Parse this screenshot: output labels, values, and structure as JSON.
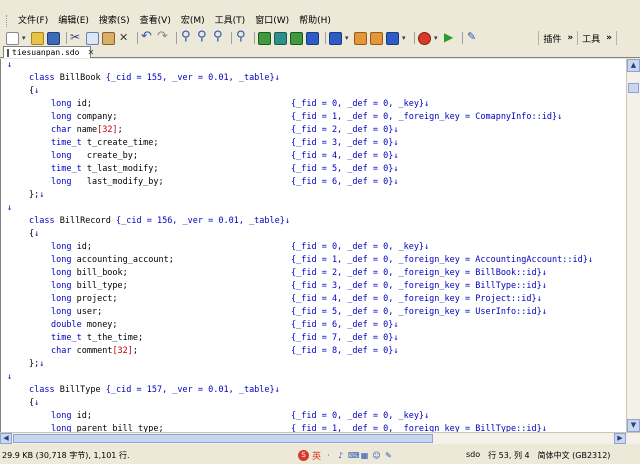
{
  "menubar": {
    "items": [
      "文件(F)",
      "编辑(E)",
      "搜索(S)",
      "查看(V)",
      "宏(M)",
      "工具(T)",
      "窗口(W)",
      "帮助(H)"
    ]
  },
  "toolbar": {
    "plugins_label": "插件",
    "tools_label": "工具",
    "chevron": "»"
  },
  "tab": {
    "label": "tiesuanpan.sdo",
    "close": "✕"
  },
  "code": {
    "eol": "↓",
    "lines": [
      {
        "indent": 0,
        "left": "",
        "right": ""
      },
      {
        "indent": 1,
        "left": "class BillBook {_cid = 155, _ver = 0.01, _table}",
        "right": ""
      },
      {
        "indent": 1,
        "left": "{",
        "right": ""
      },
      {
        "indent": 2,
        "left": "long id;",
        "right": "{_fid = 0, _def = 0, _key}"
      },
      {
        "indent": 2,
        "left": "long company;",
        "right": "{_fid = 1, _def = 0, _foreign_key = ComapnyInfo::id}"
      },
      {
        "indent": 2,
        "left": "char name[32];",
        "right": "{_fid = 2, _def = 0}"
      },
      {
        "indent": 2,
        "left": "time_t t_create_time;",
        "right": "{_fid = 3, _def = 0}"
      },
      {
        "indent": 2,
        "left": "long   create_by;",
        "right": "{_fid = 4, _def = 0}"
      },
      {
        "indent": 2,
        "left": "time_t t_last_modify;",
        "right": "{_fid = 5, _def = 0}"
      },
      {
        "indent": 2,
        "left": "long   last_modify_by;",
        "right": "{_fid = 6, _def = 0}"
      },
      {
        "indent": 1,
        "left": "};",
        "right": ""
      },
      {
        "indent": 0,
        "left": "",
        "right": ""
      },
      {
        "indent": 1,
        "left": "class BillRecord {_cid = 156, _ver = 0.01, _table}",
        "right": ""
      },
      {
        "indent": 1,
        "left": "{",
        "right": ""
      },
      {
        "indent": 2,
        "left": "long id;",
        "right": "{_fid = 0, _def = 0, _key}"
      },
      {
        "indent": 2,
        "left": "long accounting_account;",
        "right": "{_fid = 1, _def = 0, _foreign_key = AccountingAccount::id}"
      },
      {
        "indent": 2,
        "left": "long bill_book;",
        "right": "{_fid = 2, _def = 0, _foreign_key = BillBook::id}"
      },
      {
        "indent": 2,
        "left": "long bill_type;",
        "right": "{_fid = 3, _def = 0, _foreign_key = BillType::id}"
      },
      {
        "indent": 2,
        "left": "long project;",
        "right": "{_fid = 4, _def = 0, _foreign_key = Project::id}"
      },
      {
        "indent": 2,
        "left": "long user;",
        "right": "{_fid = 5, _def = 0, _foreign_key = UserInfo::id}"
      },
      {
        "indent": 2,
        "left": "double money;",
        "right": "{_fid = 6, _def = 0}"
      },
      {
        "indent": 2,
        "left": "time_t t_the_time;",
        "right": "{_fid = 7, _def = 0}"
      },
      {
        "indent": 2,
        "left": "char comment[32];",
        "right": "{_fid = 8, _def = 0}"
      },
      {
        "indent": 1,
        "left": "};",
        "right": ""
      },
      {
        "indent": 0,
        "left": "",
        "right": ""
      },
      {
        "indent": 1,
        "left": "class BillType {_cid = 157, _ver = 0.01, _table}",
        "right": ""
      },
      {
        "indent": 1,
        "left": "{",
        "right": ""
      },
      {
        "indent": 2,
        "left": "long id;",
        "right": "{_fid = 0, _def = 0, _key}"
      },
      {
        "indent": 2,
        "left": "long parent_bill_type;",
        "right": "{_fid = 1, _def = 0, _foreign_key = BillType::id}"
      }
    ]
  },
  "statusbar": {
    "left": "29.9 KB (30,718 字节), 1,101 行.",
    "ime_label": "英",
    "file_type": "sdo",
    "position": "行 53, 列 4",
    "encoding": "简体中文 (GB2312)"
  }
}
